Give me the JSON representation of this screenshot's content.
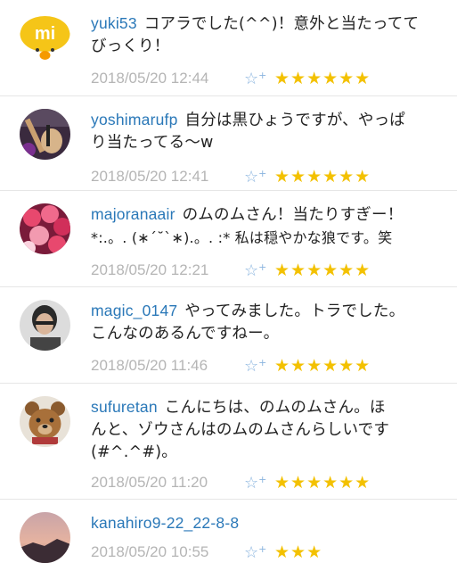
{
  "comments": [
    {
      "username": "yuki53",
      "text_line1": "コアラでした(^^)！意外と当たってて",
      "text_line2": "びっくり！",
      "timestamp": "2018/05/20 12:44",
      "stars": "★★★★★★",
      "avatar": "mixi-bird-avatar"
    },
    {
      "username": "yoshimarufp",
      "text_line1": "自分は黒ひょうですが、やっぱ",
      "text_line2": "り当たってる〜w",
      "timestamp": "2018/05/20 12:41",
      "stars": "★★★★★★",
      "avatar": "guitar-photo-avatar"
    },
    {
      "username": "majoranaair",
      "text_line1": "のムのムさん！当たりすぎー！",
      "text_line2": "*:.。. (∗ˊ˘ˋ∗).。. :* 私は穏やかな狼です。笑",
      "timestamp": "2018/05/20 12:21",
      "stars": "★★★★★★",
      "avatar": "flowers-photo-avatar"
    },
    {
      "username": "magic_0147",
      "text_line1": "やってみました。トラでした。",
      "text_line2": "こんなのあるんですねー。",
      "timestamp": "2018/05/20 11:46",
      "stars": "★★★★★★",
      "avatar": "person-photo-avatar"
    },
    {
      "username": "sufuretan",
      "text_line1": "こんにちは、のムのムさん。ほ",
      "text_line2": "んと、ゾウさんはのムのムさんらしいです",
      "text_line3": "(#^.^#)。",
      "timestamp": "2018/05/20 11:20",
      "stars": "★★★★★★",
      "avatar": "teddy-bear-avatar"
    },
    {
      "username": "kanahiro9-22_22-8-8",
      "text_line1": "",
      "text_line2": "",
      "timestamp": "2018/05/20 10:55",
      "stars": "★★★",
      "avatar": "sunset-photo-avatar"
    }
  ],
  "star_add_icon": "☆+",
  "colors": {
    "username": "#2a78b8",
    "timestamp": "#b5b5b5",
    "star": "#f3c100",
    "star_add": "#8ab4df"
  }
}
